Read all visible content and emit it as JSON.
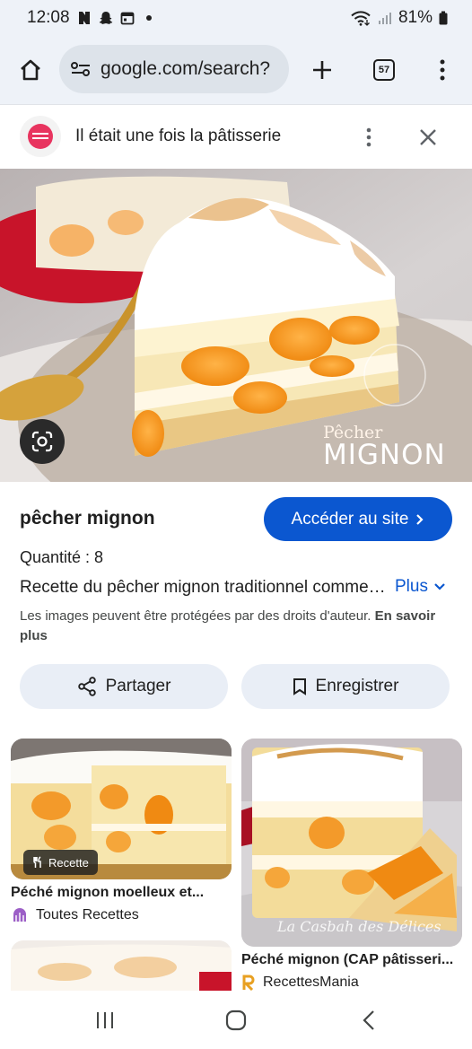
{
  "status_bar": {
    "time": "12:08",
    "battery": "81%",
    "icons": [
      "notification-icon",
      "snapchat-icon",
      "calendar-icon",
      "dot-icon",
      "wifi-icon",
      "signal-icon",
      "battery-icon"
    ]
  },
  "toolbar": {
    "url": "google.com/search?",
    "tab_count": "57",
    "icons": [
      "home-icon",
      "site-settings-icon",
      "new-tab-icon",
      "tabs-icon",
      "more-icon"
    ]
  },
  "site_header": {
    "site_name": "Il était une fois la pâtisserie",
    "icons": [
      "site-logo",
      "more-icon",
      "close-icon"
    ]
  },
  "hero": {
    "watermark_line1": "Pêcher",
    "watermark_line2": "MIGNON",
    "icons": [
      "lens-icon"
    ]
  },
  "details": {
    "title": "pêcher mignon",
    "visit_button": "Accéder au site",
    "quantity": "Quantité : 8",
    "description": "Recette du pêcher mignon traditionnel comme à la pâtisserie",
    "more_link": "Plus",
    "copyright": "Les images peuvent être protégées par des droits d'auteur.",
    "learn_more": "En savoir plus",
    "share_button": "Partager",
    "save_button": "Enregistrer"
  },
  "related": [
    {
      "title": "Péché mignon moelleux et...",
      "source": "Toutes Recettes",
      "badge": "Recette"
    },
    {
      "title": "Péché mignon (CAP pâtisseri...",
      "source": "RecettesMania",
      "watermark": "La Casbah des Délices"
    }
  ],
  "colors": {
    "accent": "#0b57d0",
    "chrome_bg": "#eef2f8",
    "pill_bg": "#e9eef6"
  },
  "navbar": {
    "icons": [
      "recents-icon",
      "home-nav-icon",
      "back-icon"
    ]
  }
}
